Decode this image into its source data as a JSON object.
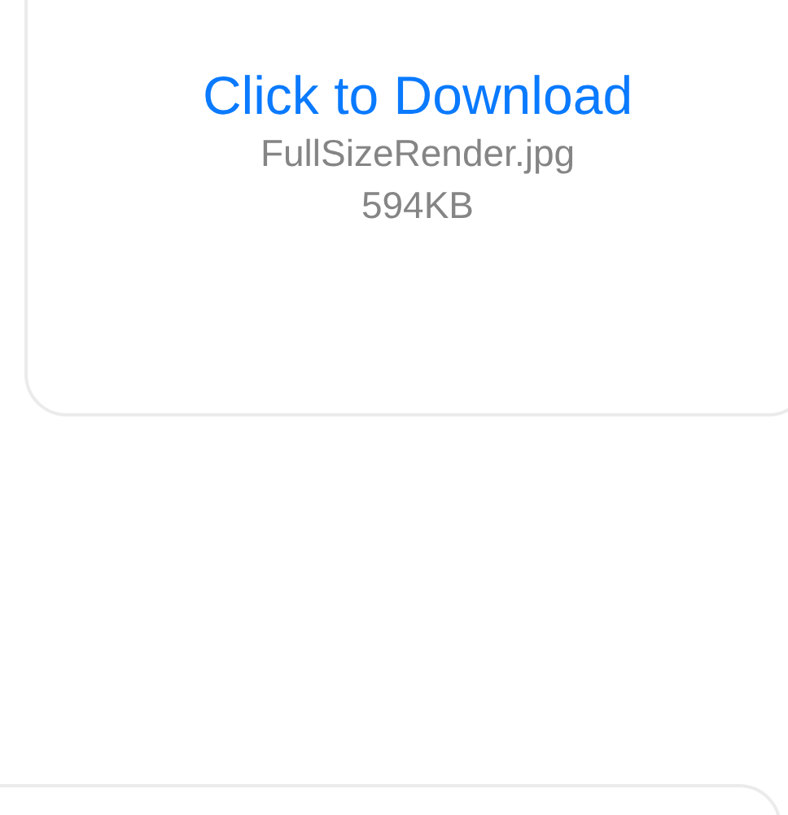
{
  "attachment": {
    "link": "Click to Download",
    "filename": "FullSizeRender.jpg",
    "size": "594KB"
  }
}
